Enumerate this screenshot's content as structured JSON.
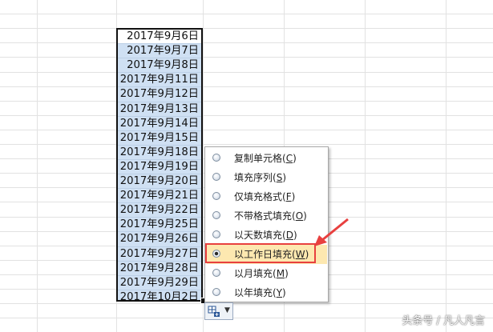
{
  "sheet": {
    "dates": [
      "2017年9月6日",
      "2017年9月7日",
      "2017年9月8日",
      "2017年9月11日",
      "2017年9月12日",
      "2017年9月13日",
      "2017年9月14日",
      "2017年9月15日",
      "2017年9月18日",
      "2017年9月19日",
      "2017年9月20日",
      "2017年9月21日",
      "2017年9月22日",
      "2017年9月25日",
      "2017年9月26日",
      "2017年9月27日",
      "2017年9月28日",
      "2017年9月29日",
      "2017年10月2日"
    ]
  },
  "menu": {
    "items": [
      {
        "label": "复制单元格",
        "key": "C",
        "selected": false
      },
      {
        "label": "填充序列",
        "key": "S",
        "selected": false
      },
      {
        "label": "仅填充格式",
        "key": "F",
        "selected": false
      },
      {
        "label": "不带格式填充",
        "key": "O",
        "selected": false
      },
      {
        "label": "以天数填充",
        "key": "D",
        "selected": false
      },
      {
        "label": "以工作日填充",
        "key": "W",
        "selected": true
      },
      {
        "label": "以月填充",
        "key": "M",
        "selected": false
      },
      {
        "label": "以年填充",
        "key": "Y",
        "selected": false
      }
    ]
  },
  "annotation": {
    "highlight_color": "#e8403f"
  },
  "watermark": "头条号 / 凡人凡言"
}
